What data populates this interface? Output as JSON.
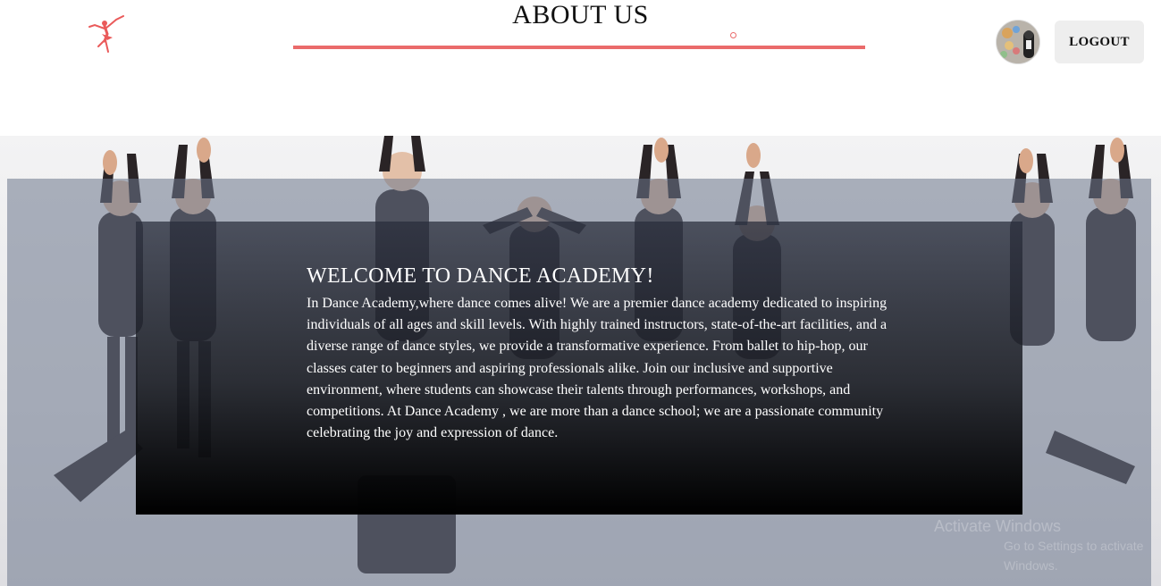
{
  "header": {
    "title": "ABOUT US",
    "logout_label": "LOGOUT",
    "accent_color": "#ea6b6b"
  },
  "icons": {
    "logo": "ballerina-logo-icon",
    "avatar": "user-avatar"
  },
  "hero": {
    "heading": "WELCOME TO DANCE ACADEMY!",
    "body": "In Dance Academy,where dance comes alive! We are a premier dance academy dedicated to inspiring individuals of all ages and skill levels. With highly trained instructors, state-of-the-art facilities, and a diverse range of dance styles, we provide a transformative experience. From ballet to hip-hop, our classes cater to beginners and aspiring professionals alike. Join our inclusive and supportive environment, where students can showcase their talents through performances, workshops, and competitions. At Dance Academy , we are more than a dance school; we are a passionate community celebrating the joy and expression of dance.",
    "background_image": "group of young dancers in black costumes posing with arms raised"
  },
  "watermark": {
    "line1": "Activate Windows",
    "line2": "Go to Settings to activate Windows."
  }
}
